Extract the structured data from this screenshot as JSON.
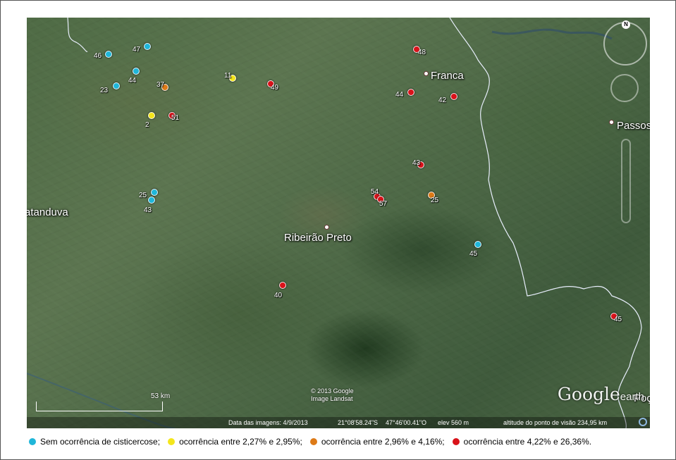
{
  "map": {
    "cities": [
      {
        "name": "Franca"
      },
      {
        "name": "Passos"
      },
      {
        "name": "Ribeirão Preto"
      },
      {
        "name": "atanduva"
      },
      {
        "name": "Poç"
      }
    ],
    "markers": [
      {
        "label": "46",
        "category": "none"
      },
      {
        "label": "47",
        "category": "none"
      },
      {
        "label": "44",
        "category": "none"
      },
      {
        "label": "23",
        "category": "none"
      },
      {
        "label": "37",
        "category": "mid"
      },
      {
        "label": "11",
        "category": "low"
      },
      {
        "label": "49",
        "category": "high"
      },
      {
        "label": "2",
        "category": "low"
      },
      {
        "label": "51",
        "category": "high"
      },
      {
        "label": "25",
        "category": "none"
      },
      {
        "label": "43",
        "category": "none"
      },
      {
        "label": "48",
        "category": "high"
      },
      {
        "label": "44",
        "category": "high"
      },
      {
        "label": "42",
        "category": "high"
      },
      {
        "label": "43",
        "category": "high"
      },
      {
        "label": "54",
        "category": "high"
      },
      {
        "label": "57",
        "category": "high"
      },
      {
        "label": "25",
        "category": "mid"
      },
      {
        "label": "45",
        "category": "none"
      },
      {
        "label": "40",
        "category": "high"
      },
      {
        "label": "45",
        "category": "high"
      }
    ],
    "scale_label": "53 km",
    "copyright_line1": "© 2013 Google",
    "copyright_line2": "Image Landsat",
    "logo_main": "Google",
    "logo_sub": "earth",
    "compass_letter": "N",
    "status": {
      "date": "Data das imagens: 4/9/2013",
      "lat": "21°08'58.24\"S",
      "lon": "47°46'00.41\"O",
      "elev": "elev  560 m",
      "altitude": "altitude do ponto de visão 234,95 km"
    }
  },
  "legend": {
    "items": [
      {
        "label": "Sem ocorrência de cisticercose;",
        "color": "#1fb6d9"
      },
      {
        "label": "ocorrência entre 2,27% e 2,95%;",
        "color": "#f4e61b"
      },
      {
        "label": "ocorrência entre 2,96% e 4,16%;",
        "color": "#dd7a17"
      },
      {
        "label": "ocorrência entre 4,22% e 26,36%.",
        "color": "#d9121a"
      }
    ]
  },
  "colors": {
    "none": "#1fb6d9",
    "low": "#f4e61b",
    "mid": "#dd7a17",
    "high": "#d9121a"
  }
}
